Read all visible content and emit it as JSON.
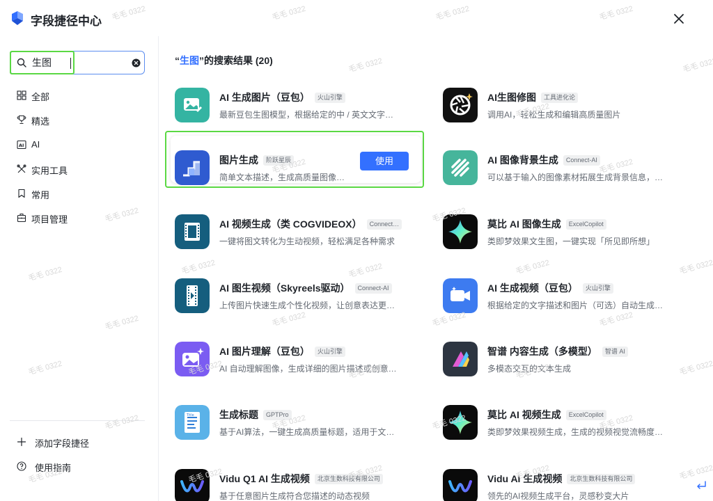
{
  "header": {
    "title": "字段捷径中心",
    "close_icon": "close-icon",
    "logo_icon": "app-logo-icon"
  },
  "search": {
    "value": "生图",
    "placeholder": "",
    "clear_icon": "clear-icon"
  },
  "sidebar": {
    "items": [
      {
        "label": "全部",
        "icon": "grid-icon"
      },
      {
        "label": "精选",
        "icon": "trophy-icon"
      },
      {
        "label": "AI",
        "icon": "ai-icon"
      },
      {
        "label": "实用工具",
        "icon": "tools-icon"
      },
      {
        "label": "常用",
        "icon": "bookmark-icon"
      },
      {
        "label": "项目管理",
        "icon": "briefcase-icon"
      }
    ],
    "bottom": [
      {
        "label": "添加字段捷径",
        "icon": "plus-icon"
      },
      {
        "label": "使用指南",
        "icon": "help-icon"
      }
    ]
  },
  "results": {
    "prefix": "“",
    "keyword": "生图",
    "suffix": "”的搜索结果 (20)"
  },
  "use_button_label": "使用",
  "watermark": "毛毛 0322",
  "cards": [
    {
      "title": "AI 生成图片（豆包）",
      "badge": "火山引擎",
      "desc": "最新豆包生图模型，根据给定的中 / 英文文字…",
      "icon": "image-edit-icon",
      "color": "#34b4a2"
    },
    {
      "title": "AI生图修图",
      "badge": "工具进化论",
      "desc": "调用AI，轻松生成和编辑高质量图片",
      "icon": "aperture-icon",
      "color": "#111111"
    },
    {
      "title": "图片生成",
      "badge": "阶跃星辰",
      "desc": "简单文本描述，生成高质量图像…",
      "icon": "stepfun-icon",
      "color": "#2f5bd0"
    },
    {
      "title": "AI 图像背景生成",
      "badge": "Connect-AI",
      "desc": "可以基于输入的图像素材拓展生成背景信息，…",
      "icon": "stripes-icon",
      "color": "#46b59b"
    },
    {
      "title": "AI 视频生成（类 COGVIDEOX）",
      "badge": "Connect…",
      "desc": "一键将图文转化为生动视频，轻松满足各种需求",
      "icon": "film-icon",
      "color": "#155e7e"
    },
    {
      "title": "莫比 AI 图像生成",
      "badge": "ExcelCopilot",
      "desc": "类即梦效果文生图，一键实现「所见即所想」",
      "icon": "sparkle-icon",
      "color": "#0b0b0b"
    },
    {
      "title": "AI 图生视频（Skyreels驱动）",
      "badge": "Connect-AI",
      "desc": "上传图片快速生成个性化视频，让创意表达更…",
      "icon": "film-strip-icon",
      "color": "#155e7e"
    },
    {
      "title": "AI 生成视频（豆包）",
      "badge": "火山引擎",
      "desc": "根据给定的文字描述和图片（可选）自动生成…",
      "icon": "video-camera-icon",
      "color": "#3d7bf0"
    },
    {
      "title": "AI 图片理解（豆包）",
      "badge": "火山引擎",
      "desc": "AI 自动理解图像，生成详细的图片描述或创意…",
      "icon": "image-sparkle-icon",
      "color": "#7b5cf2"
    },
    {
      "title": "智谱 内容生成（多模型）",
      "badge": "智谱 AI",
      "desc": "多模态交互的文本生成",
      "icon": "zhipu-icon",
      "color": "#2d3541"
    },
    {
      "title": "生成标题",
      "badge": "GPTPro",
      "desc": "基于AI算法，一键生成高质量标题，适用于文…",
      "icon": "document-icon",
      "color": "#5ab2e8"
    },
    {
      "title": "莫比 AI 视频生成",
      "badge": "ExcelCopilot",
      "desc": "类即梦效果视频生成，生成的视频视觉流畅度…",
      "icon": "sparkle-icon",
      "color": "#0b0b0b"
    },
    {
      "title": "Vidu Q1 AI 生成视频",
      "badge": "北京生数科技有限公司",
      "desc": "基于任意图片生成符合您描述的动态视频",
      "icon": "vidu-icon",
      "color": "#0a0a0a"
    },
    {
      "title": "Vidu AI 生成视频",
      "badge": "北京生数科技有限公司",
      "desc": "领先的AI视频生成平台，灵感秒变大片",
      "icon": "vidu-icon",
      "color": "#0a0a0a"
    }
  ]
}
